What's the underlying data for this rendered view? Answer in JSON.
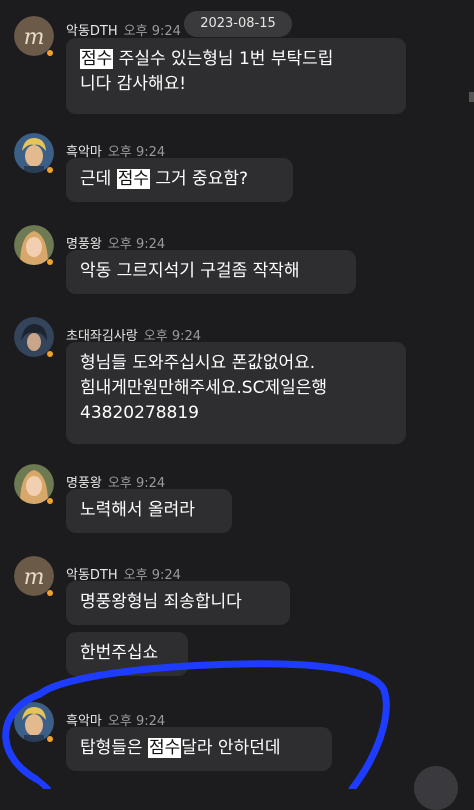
{
  "date_label": "2023-08-15",
  "messages": [
    {
      "sender": "악동DTH",
      "time": "오후 9:24",
      "avatar": "letter-m-avatar",
      "bubbles": [
        {
          "lines": [
            [
              {
                "t": "점수",
                "hl": true
              },
              {
                "t": " 주실수 있는형님 1번 부탁드립"
              }
            ],
            [
              {
                "t": "니다 감사해요!"
              }
            ]
          ]
        }
      ]
    },
    {
      "sender": "흑악마",
      "time": "오후 9:24",
      "avatar": "blond-character-avatar",
      "bubbles": [
        {
          "lines": [
            [
              {
                "t": "근데 "
              },
              {
                "t": "점수",
                "hl": true
              },
              {
                "t": " 그거 중요함?"
              }
            ]
          ]
        }
      ]
    },
    {
      "sender": "명풍왕",
      "time": "오후 9:24",
      "avatar": "elf-character-avatar",
      "bubbles": [
        {
          "lines": [
            [
              {
                "t": "악동 그르지석기 구걸좀 작작해"
              }
            ]
          ]
        }
      ]
    },
    {
      "sender": "초대좌김사랑",
      "time": "오후 9:24",
      "avatar": "dark-character-avatar",
      "bubbles": [
        {
          "lines": [
            [
              {
                "t": "형님들 도와주십시요 폰값없어요."
              }
            ],
            [
              {
                "t": "힘내게만원만해주세요.SC제일은행"
              }
            ],
            [
              {
                "t": "43820278819"
              }
            ]
          ]
        }
      ]
    },
    {
      "sender": "명풍왕",
      "time": "오후 9:24",
      "avatar": "elf-character-avatar",
      "bubbles": [
        {
          "lines": [
            [
              {
                "t": "노력해서 올려라"
              }
            ]
          ]
        }
      ]
    },
    {
      "sender": "악동DTH",
      "time": "오후 9:24",
      "avatar": "letter-m-avatar",
      "bubbles": [
        {
          "lines": [
            [
              {
                "t": "명풍왕형님 죄송합니다"
              }
            ]
          ]
        },
        {
          "lines": [
            [
              {
                "t": "한번주십쇼"
              }
            ]
          ]
        }
      ]
    },
    {
      "sender": "흑악마",
      "time": "오후 9:24",
      "avatar": "blond-character-avatar",
      "bubbles": [
        {
          "lines": [
            [
              {
                "t": "탑형들은 "
              },
              {
                "t": "점수",
                "hl": true
              },
              {
                "t": "달라 안하던데"
              }
            ]
          ]
        }
      ]
    }
  ],
  "colors": {
    "background": "#1c1c1e",
    "bubble": "#2e2e30",
    "highlight": "#ffffff",
    "annotation_stroke": "#1e3cff",
    "online_dot": "#f3a32d"
  }
}
